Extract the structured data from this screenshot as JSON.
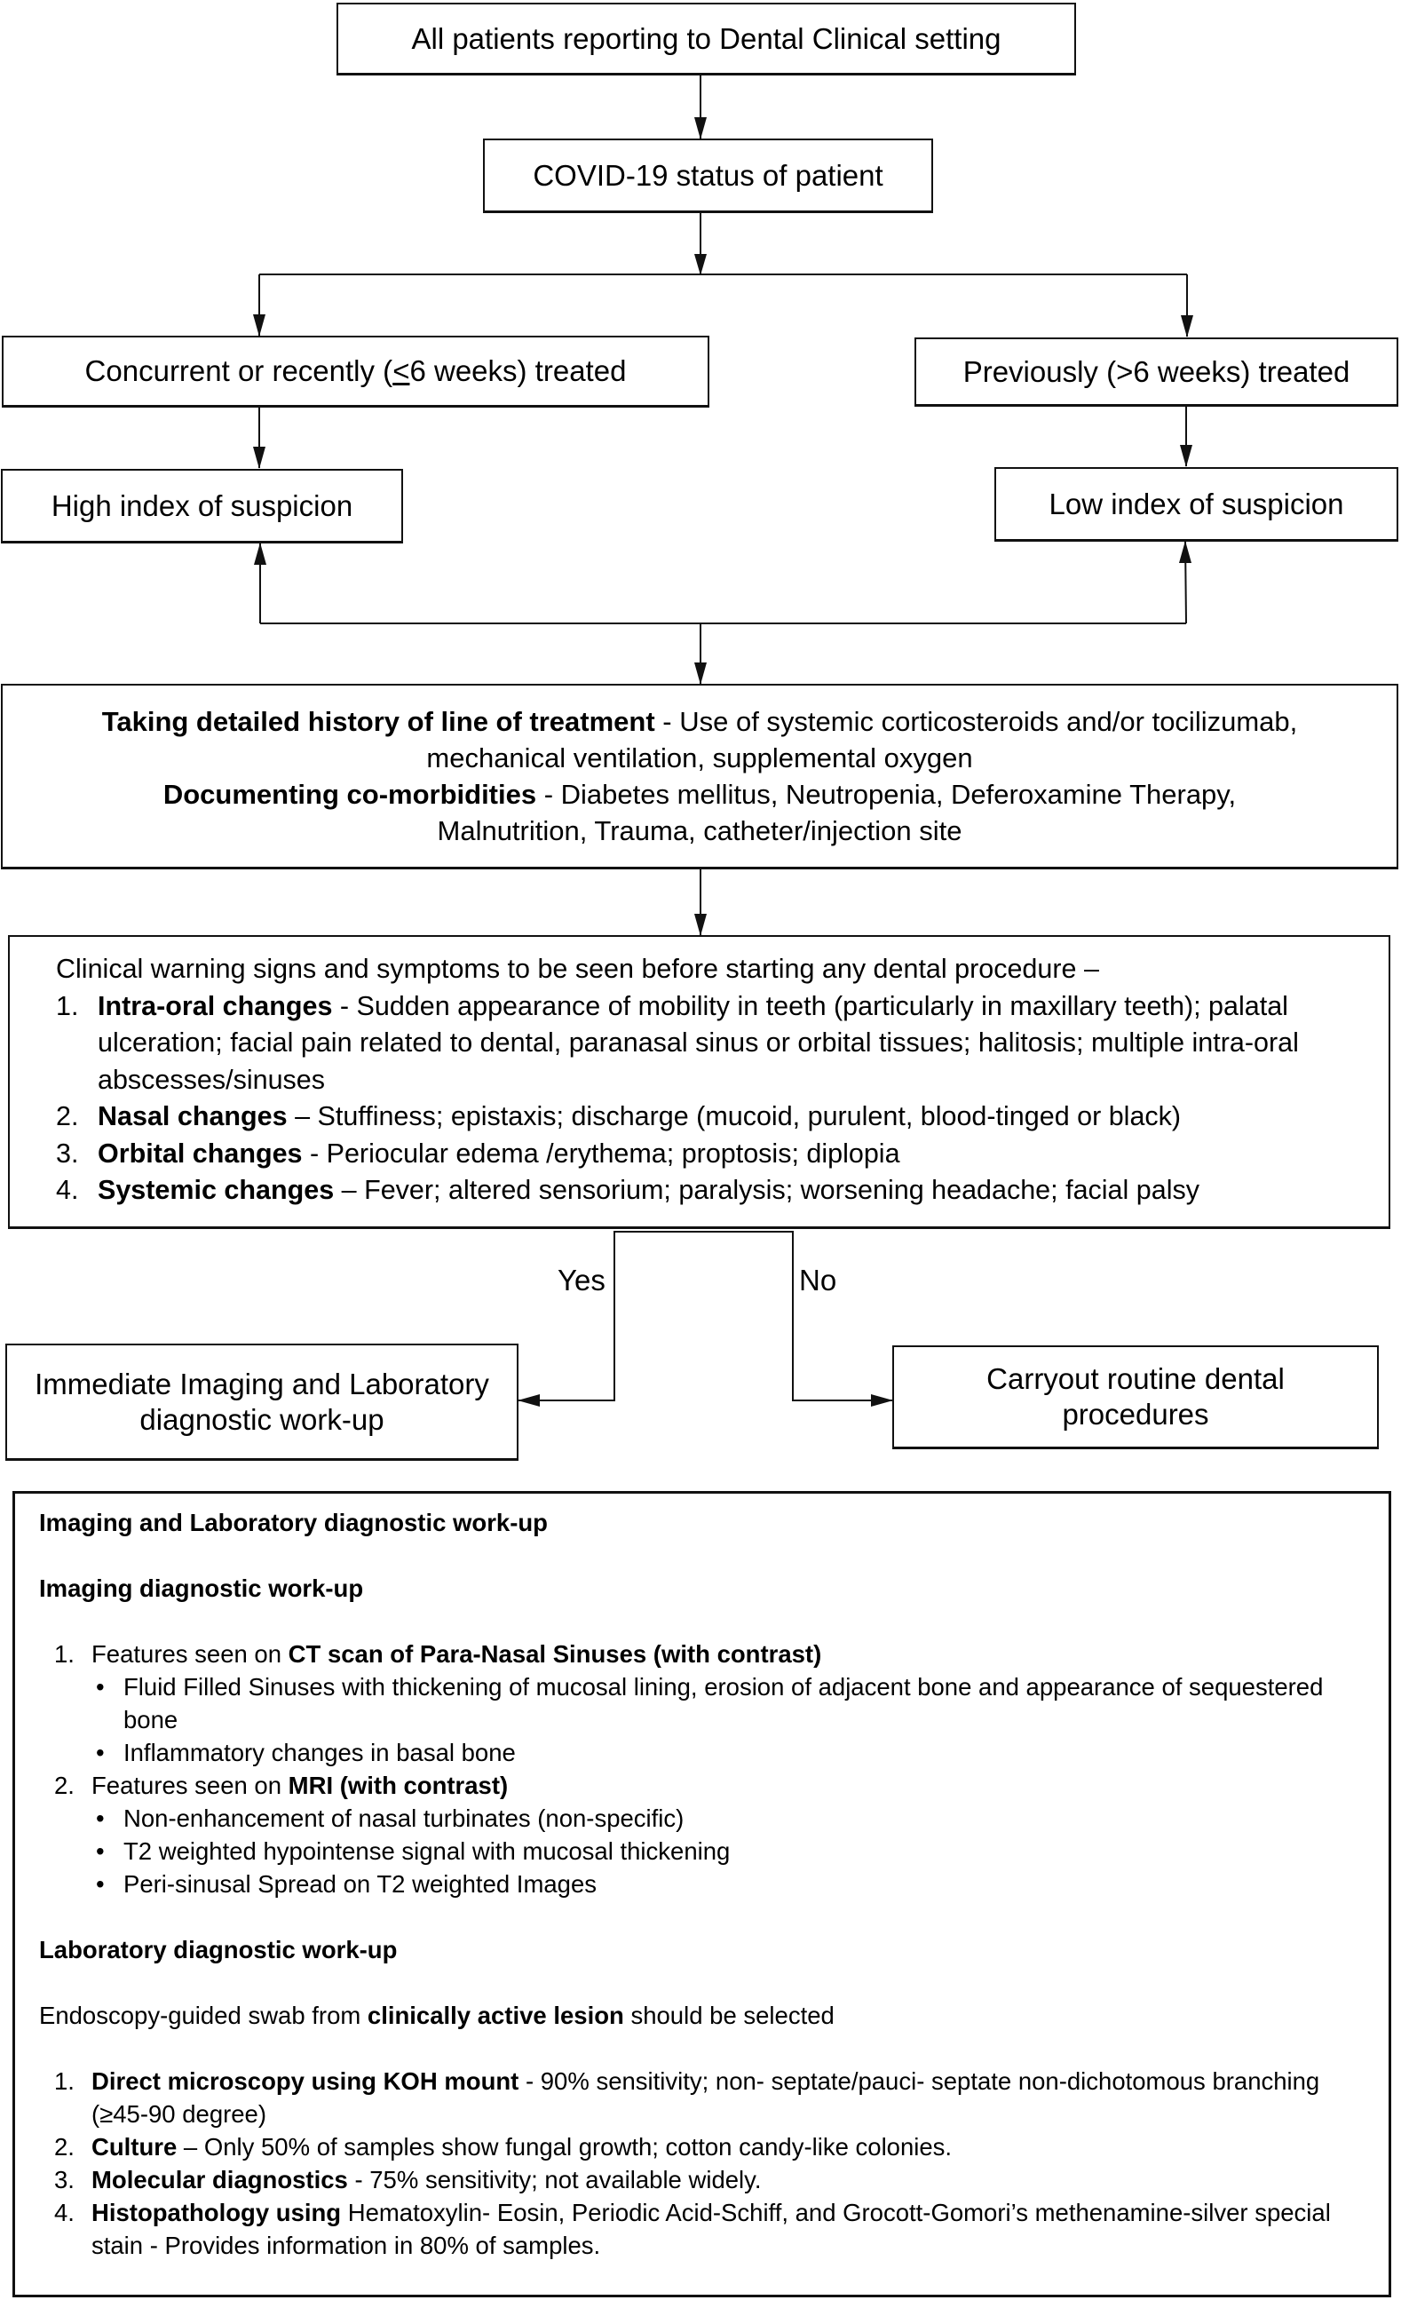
{
  "flowchart": {
    "start": "All patients reporting to Dental Clinical setting",
    "covid_status": "COVID-19 status of patient",
    "branch_recent": {
      "prefix": "Concurrent or recently (",
      "symbol": "<",
      "suffix": "6 weeks) treated"
    },
    "branch_previous": "Previously (>6 weeks) treated",
    "high_suspicion": "High index of suspicion",
    "low_suspicion": "Low index of suspicion",
    "history": {
      "line1_bold": "Taking detailed history of line of treatment",
      "line1_rest": " - Use of systemic corticosteroids and/or tocilizumab, mechanical ventilation, supplemental oxygen",
      "line2_bold": "Documenting co-morbidities",
      "line2_rest": " - Diabetes mellitus, Neutropenia, Deferoxamine Therapy, Malnutrition, Trauma, catheter/injection site"
    },
    "clinical": {
      "intro": "Clinical warning signs and symptoms to be seen before starting any dental procedure –",
      "items": [
        {
          "num": "1.",
          "bold": "Intra-oral changes",
          "rest": " - Sudden appearance of mobility in teeth (particularly in maxillary teeth); palatal ulceration; facial pain related to dental, paranasal sinus or orbital tissues; halitosis; multiple intra-oral abscesses/sinuses"
        },
        {
          "num": "2.",
          "bold": "Nasal changes",
          "rest": " – Stuffiness;  epistaxis; discharge (mucoid, purulent, blood-tinged or black)"
        },
        {
          "num": "3.",
          "bold": "Orbital changes",
          "rest": " - Periocular edema /erythema; proptosis; diplopia"
        },
        {
          "num": "4.",
          "bold": "Systemic changes",
          "rest": " – Fever; altered sensorium; paralysis; worsening headache; facial palsy"
        }
      ]
    },
    "decision": {
      "yes": "Yes",
      "no": "No"
    },
    "yes_outcome": "Immediate Imaging and Laboratory diagnostic work-up",
    "no_outcome": "Carryout routine dental procedures"
  },
  "workup": {
    "title": "Imaging and Laboratory diagnostic work-up",
    "imaging": {
      "heading": "Imaging diagnostic work-up",
      "items": [
        {
          "num": "1.",
          "pre": "Features seen on ",
          "bold": "CT scan of Para-Nasal Sinuses (with contrast)",
          "bullets": [
            "Fluid Filled Sinuses with thickening of mucosal lining, erosion of adjacent bone and appearance of sequestered bone",
            "Inflammatory changes in basal bone"
          ]
        },
        {
          "num": "2.",
          "pre": "Features seen on ",
          "bold": "MRI (with contrast)",
          "bullets": [
            "Non-enhancement of nasal turbinates (non-specific)",
            "T2 weighted hypointense signal with mucosal thickening",
            "Peri-sinusal Spread on T2 weighted Images"
          ]
        }
      ]
    },
    "laboratory": {
      "heading": "Laboratory diagnostic work-up",
      "intro_pre": "Endoscopy-guided swab from ",
      "intro_bold": "clinically active lesion",
      "intro_post": " should be selected",
      "items": [
        {
          "num": "1.",
          "bold": "Direct microscopy using KOH mount",
          "rest": "  -  90% sensitivity; non- septate/pauci- septate non-dichotomous branching (≥45-90 degree)"
        },
        {
          "num": "2.",
          "bold": "Culture",
          "rest": " – Only 50% of samples show fungal growth; cotton candy-like colonies."
        },
        {
          "num": "3.",
          "bold": "Molecular diagnostics",
          "rest": " - 75% sensitivity; not available widely."
        },
        {
          "num": "4.",
          "bold": "Histopathology using",
          "rest": " Hematoxylin- Eosin, Periodic Acid-Schiff, and Grocott-Gomori’s methenamine-silver special stain - Provides information in 80% of samples."
        }
      ]
    }
  },
  "bullet_symbol": "•"
}
